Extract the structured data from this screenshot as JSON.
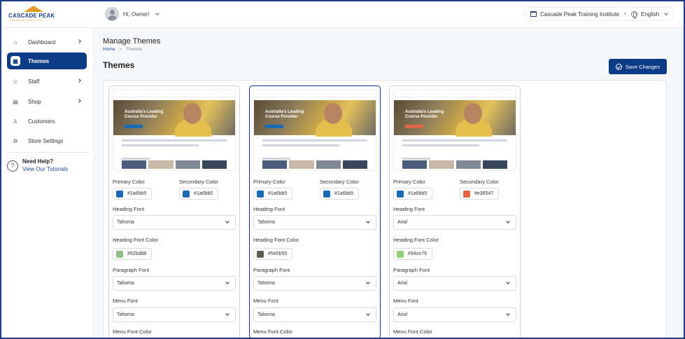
{
  "brand": {
    "name": "CASCADE PEAK",
    "tagline": "TRAINING INSTITUTE"
  },
  "header": {
    "greeting": "Hi, Owner!",
    "institute": "Cascade Peak Training Institute",
    "language": "English"
  },
  "sidebar": {
    "items": [
      {
        "label": "Dashboard",
        "icon": "home-icon",
        "active": false,
        "has_children": true
      },
      {
        "label": "Themes",
        "icon": "themes-icon",
        "active": true,
        "has_children": false
      },
      {
        "label": "Staff",
        "icon": "users-icon",
        "active": false,
        "has_children": true
      },
      {
        "label": "Shop",
        "icon": "shop-icon",
        "active": false,
        "has_children": true
      },
      {
        "label": "Customers",
        "icon": "customer-icon",
        "active": false,
        "has_children": false
      },
      {
        "label": "Store Settings",
        "icon": "gear-icon",
        "active": false,
        "has_children": false
      }
    ],
    "help": {
      "title": "Need Help?",
      "link": "View Our Tutorials"
    }
  },
  "page": {
    "title": "Manage Themes",
    "breadcrumb": {
      "home": "Home",
      "sep": ">",
      "current": "Themes"
    },
    "section_title": "Themes",
    "save_label": "Save Changes"
  },
  "labels": {
    "primary": "Primary Color",
    "secondary": "Secondary Color",
    "heading_font": "Heading Font",
    "heading_font_color": "Heading Font Color",
    "paragraph_font": "Paragraph Font",
    "menu_font": "Menu Font",
    "menu_font_color": "Menu Font Color"
  },
  "themes": [
    {
      "selected": false,
      "primary": "#1a6bb5",
      "secondary": "#1a6bb5",
      "heading_font": "Tahoma",
      "heading_color": "#92bd88",
      "paragraph_font": "Tahoma",
      "menu_font": "Tahoma",
      "thumb_title": "Australia's Leading Course Provider"
    },
    {
      "selected": true,
      "primary": "#1a6bb5",
      "secondary": "#1a6bb5",
      "heading_font": "Tahoma",
      "heading_color": "#5e5b55",
      "paragraph_font": "Tahoma",
      "menu_font": "Tahoma",
      "thumb_title": "Australia's Leading Course Provider"
    },
    {
      "selected": false,
      "primary": "#1a6bb5",
      "secondary": "#e36547",
      "heading_font": "Arial",
      "heading_color": "#94ce79",
      "paragraph_font": "Arial",
      "menu_font": "Arial",
      "thumb_title": "Australia's Leading Course Provider"
    }
  ],
  "colors": {
    "brand_navy": "#0c3c86",
    "accent_orange": "#e39b2b"
  }
}
